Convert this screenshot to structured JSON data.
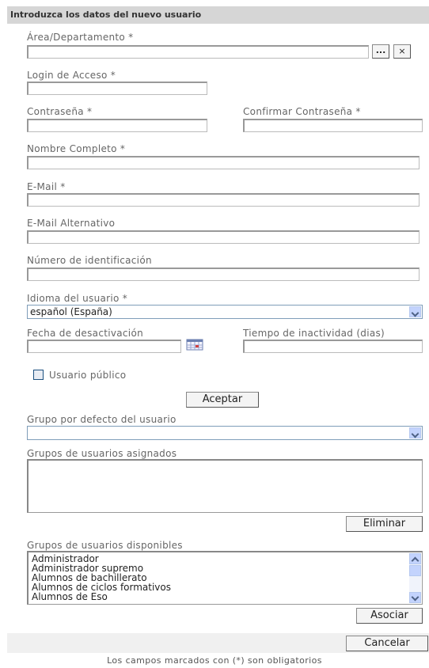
{
  "header": {
    "title": "Introduzca los datos del nuevo usuario"
  },
  "area": {
    "label": "Área/Departamento *",
    "value": "",
    "browse_label": "...",
    "clear_label": "×"
  },
  "login": {
    "label": "Login de Acceso *",
    "value": ""
  },
  "password": {
    "label": "Contraseña *",
    "value": ""
  },
  "confirm_password": {
    "label": "Confirmar Contraseña *",
    "value": ""
  },
  "full_name": {
    "label": "Nombre Completo *",
    "value": ""
  },
  "email": {
    "label": "E-Mail *",
    "value": ""
  },
  "alt_email": {
    "label": "E-Mail Alternativo",
    "value": ""
  },
  "id_number": {
    "label": "Número de identificación",
    "value": ""
  },
  "language": {
    "label": "Idioma del usuario *",
    "selected": "español (España)"
  },
  "deactivation_date": {
    "label": "Fecha de desactivación",
    "value": "",
    "icon": "calendar-icon"
  },
  "inactivity": {
    "label": "Tiempo de inactividad (dias)",
    "value": ""
  },
  "public_user": {
    "label": "Usuario público",
    "checked": false
  },
  "accept_button": {
    "label": "Aceptar"
  },
  "default_group": {
    "label": "Grupo por defecto del usuario",
    "selected": ""
  },
  "assigned_groups": {
    "label": "Grupos de usuarios asignados",
    "items": [],
    "remove_label": "Eliminar"
  },
  "available_groups": {
    "label": "Grupos de usuarios disponibles",
    "items": [
      "Administrador",
      "Administrador supremo",
      "Alumnos de bachillerato",
      "Alumnos de ciclos formativos",
      "Alumnos de Eso"
    ],
    "associate_label": "Asociar"
  },
  "cancel_button": {
    "label": "Cancelar"
  },
  "footer": {
    "note": "Los campos marcados con (*) son obligatorios"
  },
  "colors": {
    "header_bg": "#d6d6d6",
    "select_arrow": "#c3d3fd",
    "border": "#7f9db9"
  }
}
